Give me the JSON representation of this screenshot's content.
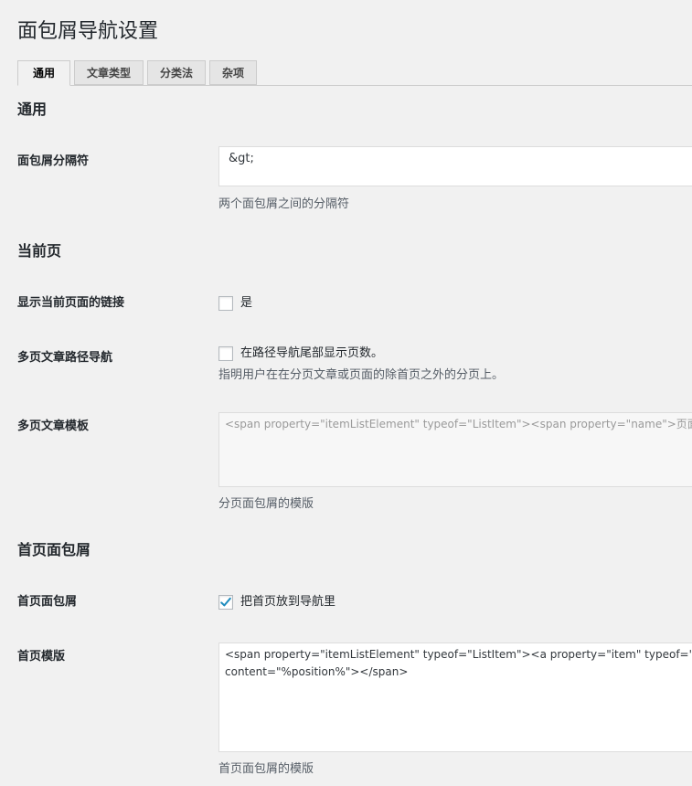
{
  "page": {
    "title": "面包屑导航设置"
  },
  "tabs": [
    {
      "label": "通用",
      "active": true
    },
    {
      "label": "文章类型",
      "active": false
    },
    {
      "label": "分类法",
      "active": false
    },
    {
      "label": "杂项",
      "active": false
    }
  ],
  "general": {
    "section_title": "通用",
    "separator": {
      "label": "面包屑分隔符",
      "value": "&gt;",
      "description": "两个面包屑之间的分隔符"
    }
  },
  "current_page": {
    "section_title": "当前页",
    "show_link": {
      "label": "显示当前页面的链接",
      "checkbox_label": "是",
      "checked": false
    },
    "paged": {
      "label": "多页文章路径导航",
      "checkbox_label": "在路径导航尾部显示页数。",
      "description": "指明用户在在分页文章或页面的除首页之外的分页上。",
      "checked": false
    },
    "paged_template": {
      "label": "多页文章模板",
      "placeholder": "<span property=\"itemListElement\" typeof=\"ListItem\"><span property=\"name\">页面",
      "description": "分页面包屑的模版"
    }
  },
  "home": {
    "section_title": "首页面包屑",
    "home_breadcrumb": {
      "label": "首页面包屑",
      "checkbox_label": "把首页放到导航里",
      "checked": true
    },
    "home_template": {
      "label": "首页模版",
      "value": "<span property=\"itemListElement\" typeof=\"ListItem\"><a property=\"item\" typeof=\"\ncontent=\"%position%\"></span>",
      "description": "首页面包屑的模版"
    }
  },
  "colors": {
    "checkmark": "#1e8cbe"
  },
  "icons": {
    "checkmark": "checkmark-icon"
  }
}
